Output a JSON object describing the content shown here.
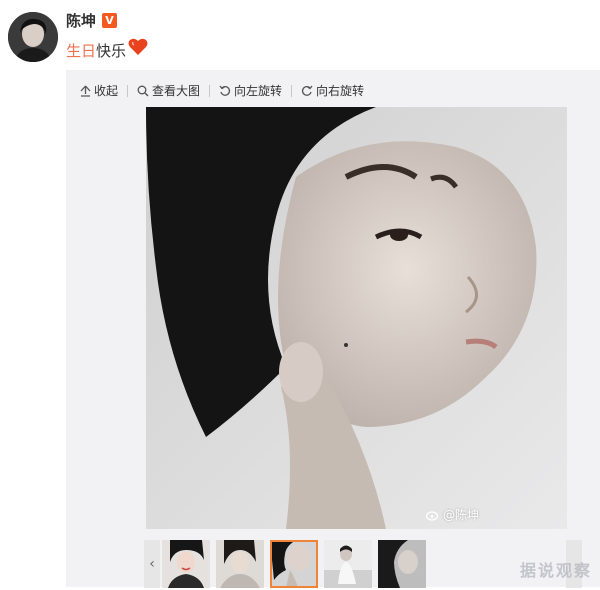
{
  "author": {
    "name": "陈坤",
    "verified_badge": "V"
  },
  "post": {
    "topic": "生日",
    "text": "快乐"
  },
  "toolbar": {
    "collapse_label": "收起",
    "view_large_label": "查看大图",
    "rotate_left_label": "向左旋转",
    "rotate_right_label": "向右旋转"
  },
  "photo": {
    "watermark_text": "@陈坤"
  },
  "thumbnails": {
    "count": 5,
    "active_index": 2
  },
  "site_watermark": "据说观察",
  "colors": {
    "topic": "#eb7350",
    "badge": "#f25a1f",
    "active_thumb_border": "#f08336",
    "media_bg": "#f2f2f5"
  }
}
